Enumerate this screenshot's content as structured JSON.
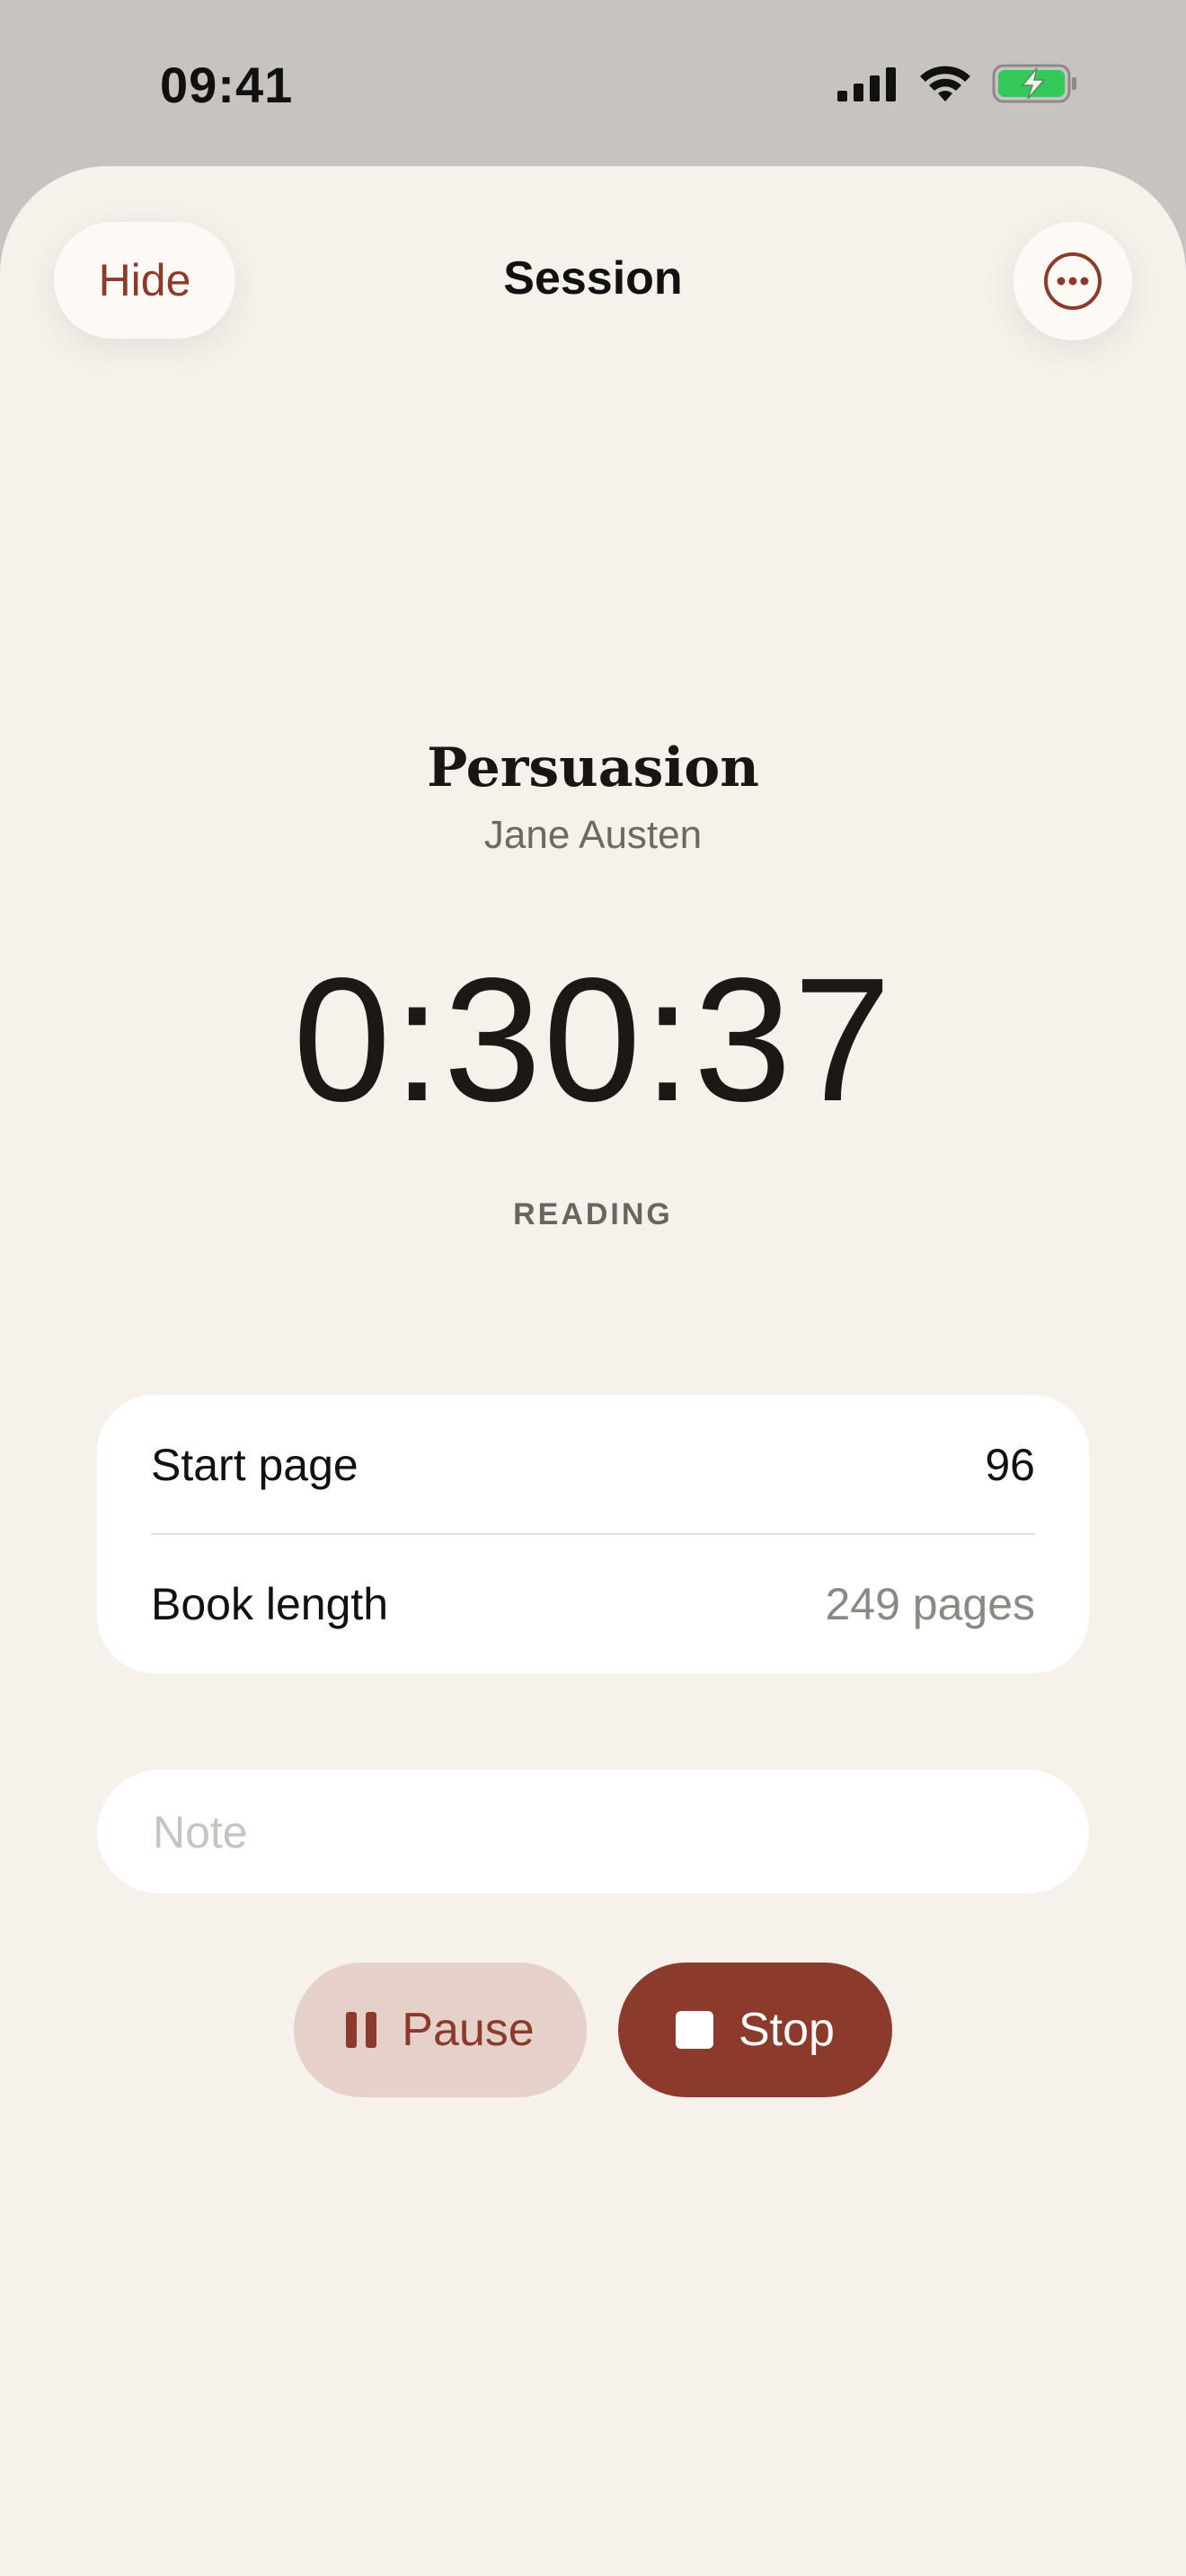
{
  "status_bar": {
    "time": "09:41"
  },
  "nav": {
    "hide_label": "Hide",
    "title": "Session"
  },
  "book": {
    "title": "Persuasion",
    "author": "Jane Austen"
  },
  "timer": {
    "elapsed": "0:30:37",
    "state": "READING"
  },
  "details": {
    "start_page_label": "Start page",
    "start_page_value": "96",
    "book_length_label": "Book length",
    "book_length_value": "249 pages"
  },
  "note": {
    "placeholder": "Note",
    "value": ""
  },
  "controls": {
    "pause_label": "Pause",
    "stop_label": "Stop"
  },
  "colors": {
    "accent": "#8b3a2b",
    "accent_soft": "#e5d1c9",
    "background": "#f6f1eb",
    "battery": "#34c759"
  }
}
